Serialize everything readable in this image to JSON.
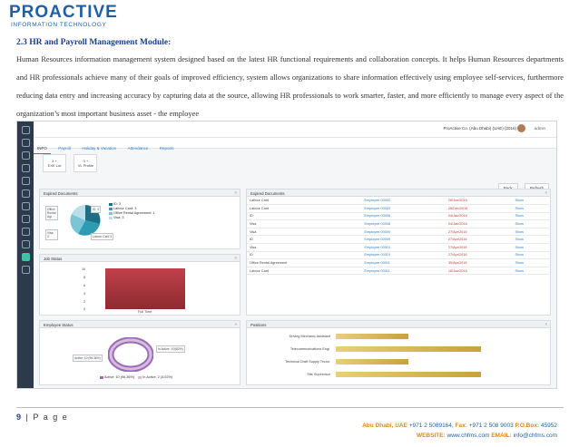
{
  "logo": {
    "main": "PROACTIVE",
    "sub": "INFORMATION TECHNOLOGY"
  },
  "section": {
    "title": "2.3  HR and Payroll Management Module:"
  },
  "paragraph": "Human Resources information management system designed based on the latest HR functional requirements and collaboration concepts. It helps Human Resources departments and HR professionals achieve many of their goals of improved efficiency, system allows organizations to share information effectively using employee self-services, furthermore reducing data entry and increasing accuracy by capturing data at the source, allowing HR professionals to work smarter, faster, and more efficiently to manage every aspect of the organization’s most important business asset - the employee",
  "app": {
    "company": "ProActive Co. (Abu Dhabi) (UAE) (2016)",
    "user": "admin",
    "tabs": [
      "INFO",
      "Payroll",
      "Holiday & Vacation",
      "Attendance",
      "Reports"
    ],
    "tiles": [
      {
        "count": "3 +",
        "label": "EXE Lot"
      },
      {
        "count": "3 +",
        "label": "VL Profile"
      }
    ],
    "buttons": {
      "back": "Back",
      "refresh": "Refresh"
    },
    "panels": {
      "expired": "Expired Documents",
      "job": "Job Status",
      "employee_status": "Employee Status",
      "expired_right": "Expired Documents",
      "positions": "Positions"
    },
    "pie_legend": [
      "ID: 3",
      "Labour Card: 3",
      "Office Rental Agreement: 1",
      "Visa: 3"
    ],
    "pie_callouts": {
      "office": "Office Rental Agr.",
      "id": "ID: 3",
      "visa": "Visa: 3",
      "labour": "Labour Card 3"
    },
    "job_chart": {
      "ticks": [
        "10",
        "8",
        "6",
        "4",
        "2",
        "0"
      ],
      "xlabel": "Full Time",
      "value": 10
    },
    "donut_labels": {
      "active": "In Active: 1/3(82%)",
      "inactive": "Active: 10 (96.36%)",
      "leg_active": "Active: 10 (96.36%)",
      "leg_inactive": "In Active: 2 (3.02%)"
    },
    "positions_labels": [
      "Driving Mechanic Assistant",
      "Telecommunications Engi.",
      "Technical Draft Supply Techn.",
      "Site Supervisor"
    ],
    "positions_values": [
      1,
      2,
      1,
      2
    ],
    "docs": {
      "headers": [
        "Expired Documents",
        "",
        "",
        ""
      ],
      "rows": [
        {
          "doc": "Labour Card",
          "emp": "Employee 00002",
          "date": "28/Jun/2016",
          "action": "Show"
        },
        {
          "doc": "Labour Card",
          "emp": "Employee 00003",
          "date": "28/Dec/2016",
          "action": "Show"
        },
        {
          "doc": "ID",
          "emp": "Employee 00008",
          "date": "04/Jan/2016",
          "action": "Show"
        },
        {
          "doc": "Visa",
          "emp": "Employee 00008",
          "date": "04/Jan/2016",
          "action": "Show"
        },
        {
          "doc": "Visa",
          "emp": "Employee 00009",
          "date": "27/Apr/2016",
          "action": "Show"
        },
        {
          "doc": "ID",
          "emp": "Employee 00009",
          "date": "27/Apr/2016",
          "action": "Show"
        },
        {
          "doc": "Visa",
          "emp": "Employee 00010",
          "date": "27/Apr/2016",
          "action": "Show"
        },
        {
          "doc": "ID",
          "emp": "Employee 00010",
          "date": "27/Apr/2016",
          "action": "Show"
        },
        {
          "doc": "Office Rental Agreement",
          "emp": "Employee 00011",
          "date": "30/Apr/2016",
          "action": "Show"
        },
        {
          "doc": "Labour Card",
          "emp": "Employee 00011",
          "date": "18/Jun/2016",
          "action": "Show"
        }
      ]
    }
  },
  "footer": {
    "page_num": "9",
    "page_label": "| P a g e",
    "contact_line1_a": "Abu Dhabi, UAE",
    "contact_line1_b": " +971 2 5089164, ",
    "contact_fax": "Fax:",
    "contact_fax_v": " +971 2 508 9003  ",
    "contact_po": "P.O.Box:",
    "contact_po_v": " 45952",
    "contact_web": "WEBSITE:",
    "contact_web_v": " www.chfms.com  ",
    "contact_email": "EMAIL:",
    "contact_email_v": " info@chfms.com"
  },
  "colors": {
    "brand": "#1f5fa8",
    "heading": "#1a3f8c",
    "accent_orange": "#d88a1b",
    "bar_red": "#a8343d",
    "bar_gold": "#d4b14f",
    "pie_teal": "#2e9bb5"
  }
}
